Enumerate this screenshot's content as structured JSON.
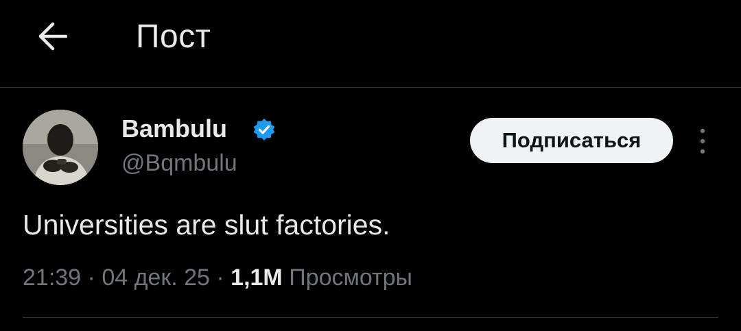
{
  "header": {
    "back_icon": "arrow-left-icon",
    "title": "Пост"
  },
  "author": {
    "display_name": "Bambulu",
    "handle": "@Bqmbulu",
    "verified_icon": "verified-badge-icon",
    "verified_color": "#1d9bf0",
    "follow_label": "Подписаться"
  },
  "post": {
    "text": "Universities are slut factories.",
    "time": "21:39",
    "date": "04 дек. 25",
    "separator": "·",
    "views_count": "1,1M",
    "views_label": "Просмотры"
  },
  "theme": {
    "background": "#000000",
    "text_primary": "#e7e9ea",
    "text_secondary": "#71767b",
    "divider": "#2f3336",
    "follow_bg": "#eff3f4"
  }
}
